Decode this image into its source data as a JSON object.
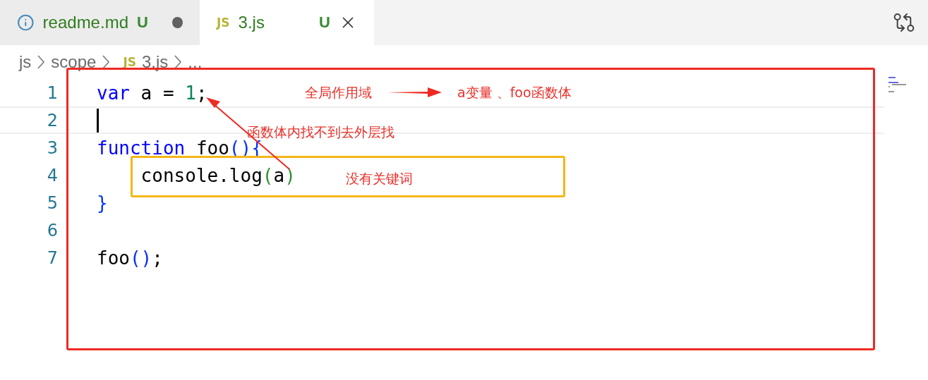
{
  "tabs": [
    {
      "label": "readme.md",
      "badge": "U",
      "dirty": true,
      "selected": false
    },
    {
      "icon_text": "JS",
      "label": "3.js",
      "badge": "U",
      "dirty": false,
      "selected": true
    }
  ],
  "breadcrumb": [
    {
      "label": "js"
    },
    {
      "label": "scope"
    },
    {
      "label": "3.js",
      "icon_text": "JS"
    },
    {
      "label": "..."
    }
  ],
  "code_lines": [
    {
      "number": "1",
      "current": false,
      "tokens": [
        {
          "kind": "keyword",
          "text": "var"
        },
        {
          "kind": "plain",
          "text": " a = "
        },
        {
          "kind": "number",
          "text": "1"
        },
        {
          "kind": "plain",
          "text": ";"
        }
      ]
    },
    {
      "number": "2",
      "current": true
    },
    {
      "number": "3",
      "current": false,
      "tokens": [
        {
          "kind": "keyword",
          "text": "function"
        },
        {
          "kind": "plain",
          "text": " foo"
        },
        {
          "kind": "bracket",
          "text": "(){"
        }
      ]
    },
    {
      "number": "4",
      "current": false,
      "tokens": [
        {
          "kind": "plain",
          "text": "    console.log"
        },
        {
          "kind": "bracket2",
          "text": "("
        },
        {
          "kind": "plain",
          "text": "a"
        },
        {
          "kind": "bracket2",
          "text": ")"
        }
      ]
    },
    {
      "number": "5",
      "current": false,
      "tokens": [
        {
          "kind": "bracket",
          "text": "}"
        }
      ]
    },
    {
      "number": "6",
      "current": false
    },
    {
      "number": "7",
      "current": false,
      "tokens": [
        {
          "kind": "plain",
          "text": "foo"
        },
        {
          "kind": "bracket",
          "text": "()"
        },
        {
          "kind": "plain",
          "text": ";"
        }
      ]
    }
  ],
  "annotations": [
    "全局作用域",
    "a变量 、foo函数体",
    "函数体内找不到去外层找",
    "没有关键词"
  ]
}
